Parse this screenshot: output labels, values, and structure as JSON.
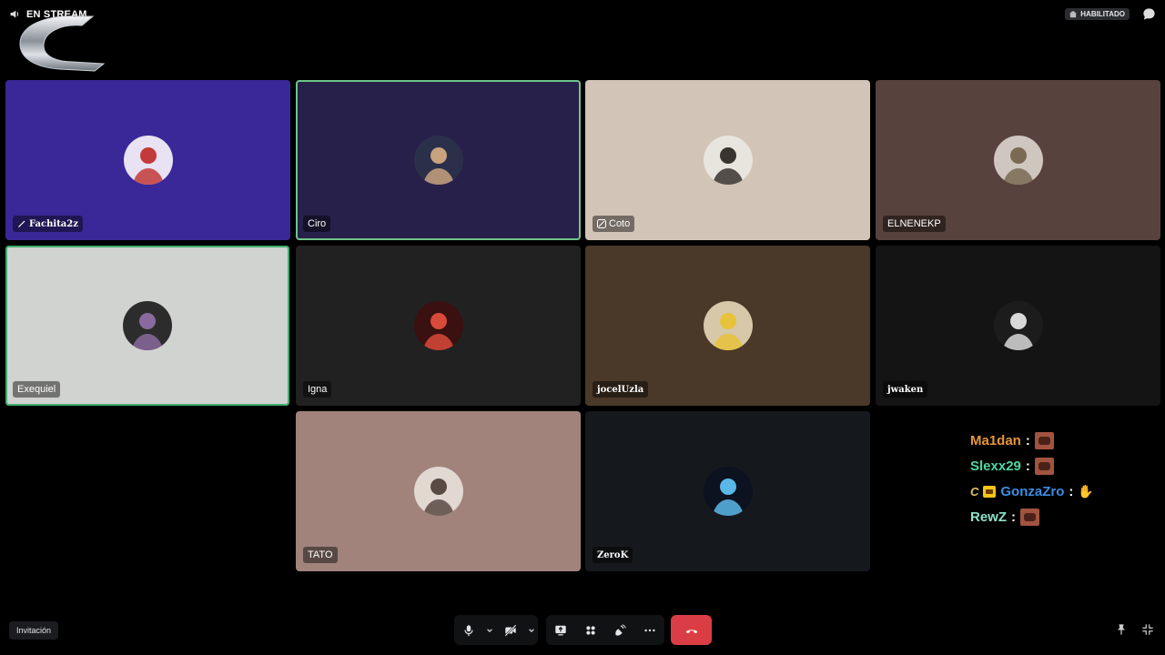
{
  "header": {
    "stream_label": "EN STREAM",
    "badge_label": "HABILITADO"
  },
  "tiles": [
    {
      "name": "Fachita2z",
      "bg": "#3a2898",
      "avatar": "#e8e2f2",
      "avatar_accent": "#c23a3a"
    },
    {
      "name": "Ciro",
      "bg": "#27204a",
      "avatar": "#2a2f4a",
      "avatar_accent": "#c9a27e"
    },
    {
      "name": "Coto",
      "bg": "#d2c4b6",
      "avatar": "#e8e4de",
      "avatar_accent": "#3a3430"
    },
    {
      "name": "ELNENEKP",
      "bg": "#58423d",
      "avatar": "#cfc7bf",
      "avatar_accent": "#7a6a52"
    },
    {
      "name": "Exequiel",
      "bg": "#d1d3d0",
      "avatar": "#2c2c2c",
      "avatar_accent": "#8a6a9e"
    },
    {
      "name": "Igna",
      "bg": "#212121",
      "avatar": "#3a1010",
      "avatar_accent": "#d84a3a"
    },
    {
      "name": "jocelUzla",
      "bg": "#4a3829",
      "avatar": "#d6c8a8",
      "avatar_accent": "#e8c23a"
    },
    {
      "name": "jwaken",
      "bg": "#141414",
      "avatar": "#1c1c1c",
      "avatar_accent": "#d8d8d8"
    },
    {
      "name": "TATO",
      "bg": "#a1837b",
      "avatar": "#e2d8d2",
      "avatar_accent": "#5a4a44"
    },
    {
      "name": "ZeroK",
      "bg": "#15191d",
      "avatar": "#0c1220",
      "avatar_accent": "#5ab8e8"
    }
  ],
  "chat": [
    {
      "user": "Ma1dan",
      "color": "#e6963a",
      "sep": ":"
    },
    {
      "user": "Slexx29",
      "color": "#4fd6a0",
      "sep": ":"
    },
    {
      "user": "GonzaZro",
      "color": "#3c8de6",
      "sep": ":",
      "prefix": "C"
    },
    {
      "user": "RewZ",
      "color": "#8ee0c8",
      "sep": ":"
    }
  ],
  "footer": {
    "invite_label": "Invitación"
  },
  "colors": {
    "hangup": "#da3e44",
    "speaking_border": "#3fae6a"
  },
  "icons": [
    "speaker-icon",
    "stream-logo",
    "badge-icon",
    "chat-icon",
    "pencil-icon",
    "muted-mic-icon",
    "microphone-icon",
    "chevron-down-icon",
    "camera-off-icon",
    "screen-share-icon",
    "activities-icon",
    "soundboard-icon",
    "more-icon",
    "hangup-icon",
    "pin-icon",
    "minimize-icon"
  ]
}
